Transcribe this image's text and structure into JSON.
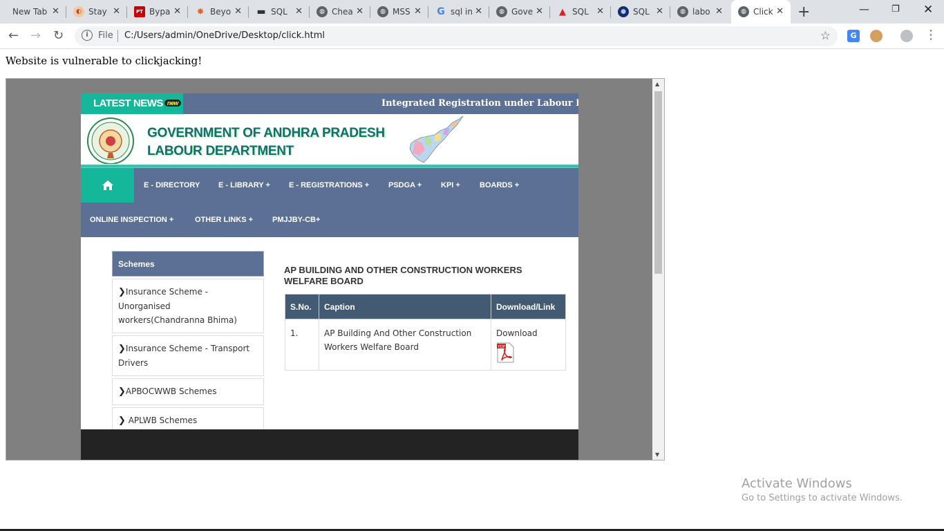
{
  "tabs": [
    {
      "title": "New Tab",
      "icon": "none"
    },
    {
      "title": "Stay",
      "icon": "chrome-store-icon"
    },
    {
      "title": "Bypa",
      "icon": "pt-icon"
    },
    {
      "title": "Beyo",
      "icon": "orange-icon"
    },
    {
      "title": "SQL",
      "icon": "dash-icon"
    },
    {
      "title": "Chea",
      "icon": "globe-icon"
    },
    {
      "title": "MSS",
      "icon": "globe-icon"
    },
    {
      "title": "sql in",
      "icon": "google-icon"
    },
    {
      "title": "Gove",
      "icon": "globe-icon"
    },
    {
      "title": "SQL",
      "icon": "red-logo-icon"
    },
    {
      "title": "SQL",
      "icon": "blue-circle-icon"
    },
    {
      "title": "labo",
      "icon": "globe-icon"
    },
    {
      "title": "Click",
      "icon": "globe-icon",
      "active": true
    }
  ],
  "toolbar": {
    "scheme_label": "File",
    "url": "C:/Users/admin/OneDrive/Desktop/click.html"
  },
  "page": {
    "message": "Website is vulnerable to clickjacking!"
  },
  "site": {
    "ticker_label": "LATEST NEWS",
    "ticker_badge": "new",
    "ticker_text": "Integrated Registration under Labour Laws",
    "title_line1": "GOVERNMENT OF ANDHRA PRADESH",
    "title_line2": "LABOUR DEPARTMENT",
    "menu": [
      "E - DIRECTORY",
      "E - LIBRARY +",
      "E - REGISTRATIONS +",
      "PSDGA +",
      "KPI +",
      "BOARDS +",
      "ONLINE INSPECTION +",
      "OTHER LINKS +",
      "PMJJBY-CB+"
    ],
    "sidebar": {
      "heading": "Schemes",
      "items": [
        "Insurance Scheme - Unorganised workers(Chandranna Bhima)",
        "Insurance Scheme - Transport Drivers",
        "APBOCWWB Schemes",
        " APLWB Schemes"
      ]
    },
    "section_title": "AP BUILDING AND OTHER CONSTRUCTION WORKERS WELFARE BOARD",
    "table": {
      "headers": [
        "S.No.",
        "Caption",
        "Download/Link"
      ],
      "rows": [
        {
          "sno": "1.",
          "caption": "AP Building And Other Construction Workers Welfare Board",
          "link": "Download"
        }
      ]
    }
  },
  "watermark": {
    "line1": "Activate Windows",
    "line2": "Go to Settings to activate Windows."
  }
}
